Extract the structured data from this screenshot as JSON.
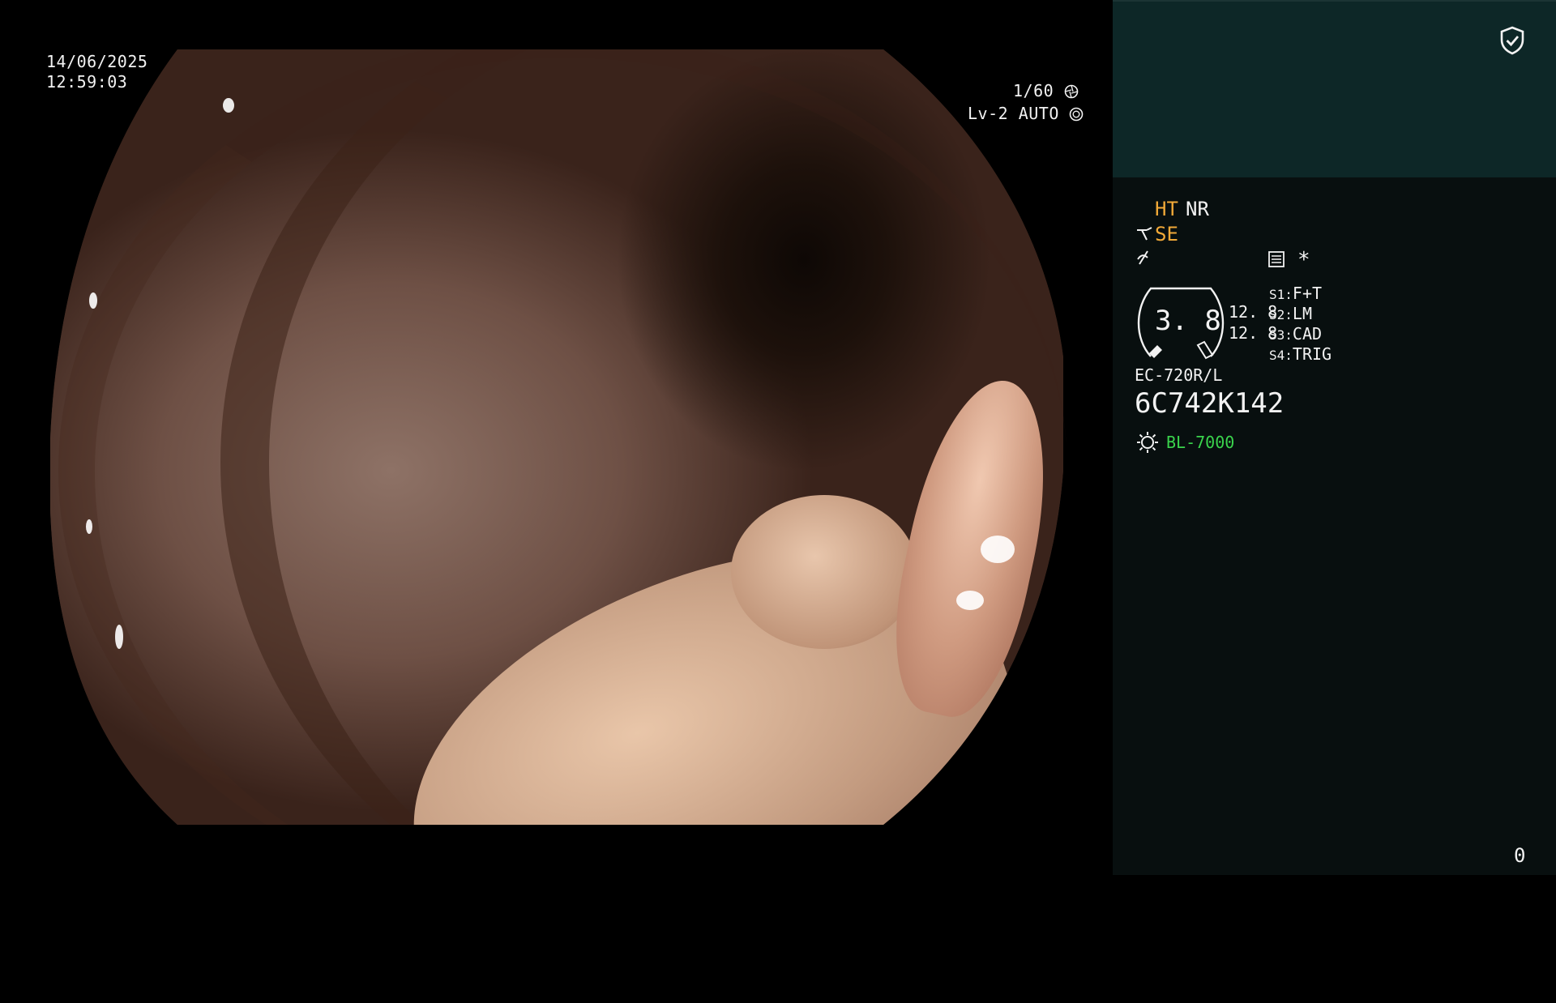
{
  "overlay": {
    "date": "14/06/2025",
    "time": "12:59:03",
    "shutter": "1/60",
    "shutter_icon": "shutter-icon",
    "level": "Lv-2",
    "exposure_mode": "AUTO",
    "exposure_icon": "iris-icon"
  },
  "panel": {
    "shield_icon": "shield-check-icon",
    "ht": "HT",
    "nr": "NR",
    "se": "SE",
    "se_icon": "tip-icon",
    "slash_icon": "not-equal-icon",
    "settings_icon": "settings-list-icon",
    "asterisk": "*",
    "gauge_value": "3. 8",
    "value_top": "12. 8",
    "value_bottom": "12. 8",
    "switches": [
      {
        "key": "S1:",
        "value": "F+T"
      },
      {
        "key": "S2:",
        "value": "LM"
      },
      {
        "key": "S3:",
        "value": "CAD"
      },
      {
        "key": "S4:",
        "value": "TRIG"
      }
    ],
    "scope_model": "EC-720R/L",
    "serial": "6C742K142",
    "light_icon": "lamp-icon",
    "light_source": "BL-7000",
    "counter": "0"
  },
  "colors": {
    "panel_bg": "#080f0f",
    "panel_top_bg": "#0d2727",
    "orange": "#f1a938",
    "green": "#3ad44c"
  }
}
